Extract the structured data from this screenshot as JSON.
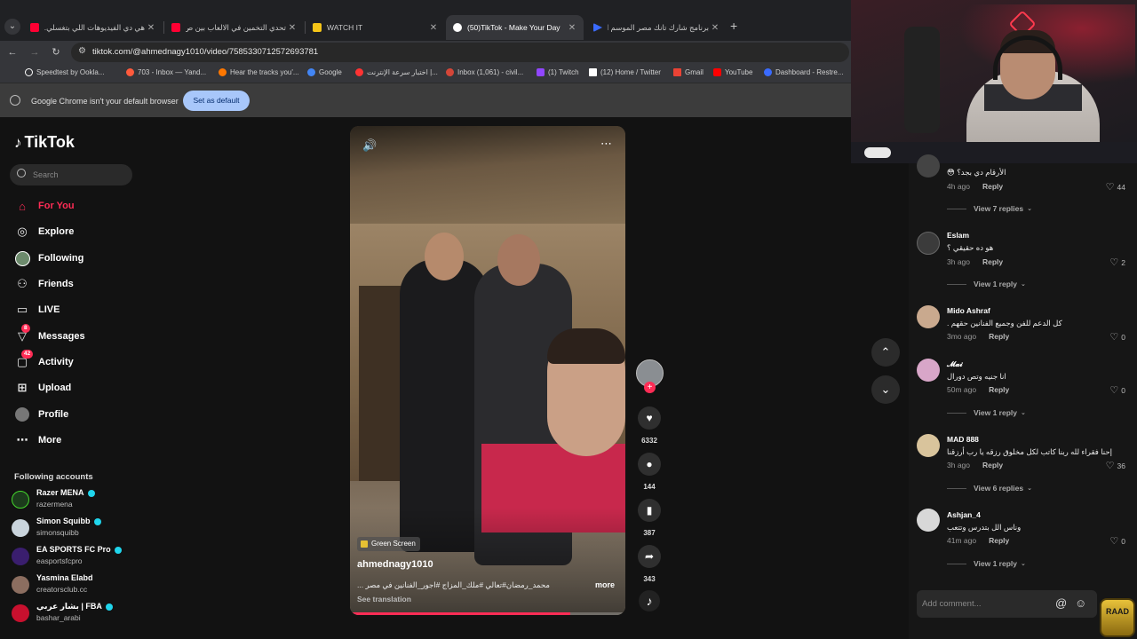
{
  "browser": {
    "tabs": [
      {
        "title": "هي دي الفيديوهات اللي بتغسلي...",
        "favicon_color": "#ff0033"
      },
      {
        "title": "تحدي التخمين في الالعاب بين ص...",
        "favicon_color": "#ff0033"
      },
      {
        "title": "WATCH IT",
        "favicon_color": "#f5c518"
      },
      {
        "title": "(50)TikTok - Make Your Day",
        "favicon_color": "#ffffff",
        "active": true
      },
      {
        "title": "برنامج شارك تانك مصر الموسم ا...",
        "favicon_color": "#3a6bff"
      }
    ],
    "new_tab": "+",
    "url": "tiktok.com/@ahmednagy1010/video/7585330712572693781",
    "bookmarks": [
      {
        "label": "Speedtest by Ookla...",
        "color": "#ffffff"
      },
      {
        "label": "703 - Inbox — Yand...",
        "color": "#ff5a3c"
      },
      {
        "label": "Hear the tracks you'...",
        "color": "#ff7700"
      },
      {
        "label": "Google",
        "color": "#4285f4"
      },
      {
        "label": "اختبار سرعة الإنترنت |...",
        "color": "#ff3333"
      },
      {
        "label": "Inbox (1,061) - civil...",
        "color": "#d44638"
      },
      {
        "label": "(1) Twitch",
        "color": "#9146ff"
      },
      {
        "label": "(12) Home / Twitter",
        "color": "#ffffff"
      },
      {
        "label": "Gmail",
        "color": "#ea4335"
      },
      {
        "label": "YouTube",
        "color": "#ff0000"
      },
      {
        "label": "Dashboard - Restre...",
        "color": "#3a6bff"
      }
    ],
    "infobar": {
      "text": "Google Chrome isn't your default browser",
      "button": "Set as default"
    }
  },
  "sidebar": {
    "logo": "TikTok",
    "search_placeholder": "Search",
    "nav": [
      {
        "label": "For You",
        "icon": "home-icon",
        "active": true
      },
      {
        "label": "Explore",
        "icon": "compass-icon"
      },
      {
        "label": "Following",
        "icon": "following-avatar-icon"
      },
      {
        "label": "Friends",
        "icon": "friends-icon"
      },
      {
        "label": "LIVE",
        "icon": "live-icon"
      },
      {
        "label": "Messages",
        "icon": "messages-icon",
        "badge": "8"
      },
      {
        "label": "Activity",
        "icon": "activity-icon",
        "badge": "42"
      },
      {
        "label": "Upload",
        "icon": "upload-icon"
      },
      {
        "label": "Profile",
        "icon": "profile-icon"
      },
      {
        "label": "More",
        "icon": "more-icon"
      }
    ],
    "following_header": "Following accounts",
    "following": [
      {
        "name": "Razer MENA",
        "user": "razermena",
        "verified": true,
        "color": "#1c3b1c"
      },
      {
        "name": "Simon Squibb",
        "user": "simonsquibb",
        "verified": true,
        "color": "#c9d4dc"
      },
      {
        "name": "EA SPORTS FC Pro",
        "user": "easportsfcpro",
        "verified": true,
        "color": "#3a1e6e"
      },
      {
        "name": "Yasmina Elabd",
        "user": "creatorsclub.cc",
        "verified": false,
        "color": "#8c6e60"
      },
      {
        "name": "بشار عربي | FBA",
        "user": "bashar_arabi",
        "verified": true,
        "color": "#c8102e"
      }
    ]
  },
  "video": {
    "effect_tag": "Green Screen",
    "author": "ahmednagy1010",
    "caption": "محمد_رمضان#تعالي #ملك_المزاج #اجور_الفنانين في مصر ...",
    "caption_more": "more",
    "see_translation": "See translation",
    "progress": 0.8,
    "likes": "6332",
    "comments": "144",
    "saves": "387",
    "shares": "343"
  },
  "comments": [
    {
      "text": "الأرقام دي بجد؟ 😳",
      "time": "4h ago",
      "reply": "Reply",
      "likes": "44",
      "replies": "View 7 replies",
      "color": "#444"
    },
    {
      "name": "Eslam",
      "text": "هو ده حقيقي ؟",
      "time": "3h ago",
      "reply": "Reply",
      "likes": "2",
      "replies": "View 1 reply",
      "color": "#3b3b3b"
    },
    {
      "name": "Mido Ashraf",
      "text": "كل الدعم للفن وجميع الفنانين حقهم .",
      "time": "3mo ago",
      "reply": "Reply",
      "likes": "0",
      "color": "#c9a98e"
    },
    {
      "name": "𝓜𝓪𝓲",
      "text": "انا جنيه وتص دورال",
      "time": "50m ago",
      "reply": "Reply",
      "likes": "0",
      "replies": "View 1 reply",
      "color": "#d8a6c8"
    },
    {
      "name": "MAD 888",
      "text": "إحنا فقراء لله ربنا كاتب لكل مخلوق رزقه يا رب أرزقنا",
      "time": "3h ago",
      "reply": "Reply",
      "likes": "36",
      "replies": "View 6 replies",
      "color": "#d9c49c"
    },
    {
      "name": "Ashjan_4",
      "text": "وناس الل بتدرس وتتعب",
      "time": "41m ago",
      "reply": "Reply",
      "likes": "0",
      "replies": "View 1 reply",
      "color": "#d8d8d8"
    }
  ],
  "add_comment_placeholder": "Add comment...",
  "overlay": {
    "streamer_badge": "RAAD"
  }
}
